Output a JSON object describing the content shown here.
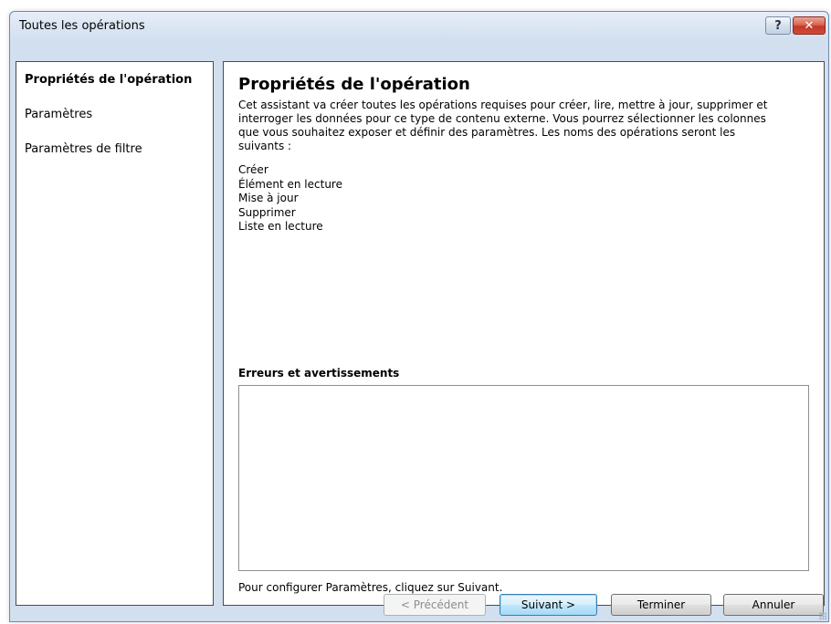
{
  "window": {
    "title": "Toutes les opérations",
    "help_glyph": "?",
    "close_glyph": "✕"
  },
  "nav": {
    "items": [
      {
        "label": "Propriétés de l'opération",
        "active": true
      },
      {
        "label": "Paramètres",
        "active": false
      },
      {
        "label": "Paramètres de filtre",
        "active": false
      }
    ]
  },
  "content": {
    "title": "Propriétés de l'opération",
    "description": "Cet assistant va créer toutes les opérations requises pour créer, lire, mettre à jour, supprimer et interroger les données pour ce type de contenu externe. Vous pourrez sélectionner les colonnes que vous souhaitez exposer et définir des paramètres. Les noms des opérations seront les suivants :",
    "operations": [
      "Créer",
      "Élément en lecture",
      "Mise à jour",
      "Supprimer",
      "Liste en lecture"
    ],
    "errors_label": "Erreurs et avertissements",
    "errors_text": "",
    "hint": "Pour configurer Paramètres, cliquez sur Suivant."
  },
  "buttons": {
    "previous": "< Précédent",
    "next": "Suivant >",
    "finish": "Terminer",
    "cancel": "Annuler"
  },
  "colors": {
    "window_background": "#d2dfee",
    "close_button": "#c0392b",
    "default_button_border": "#3c7fb1"
  }
}
